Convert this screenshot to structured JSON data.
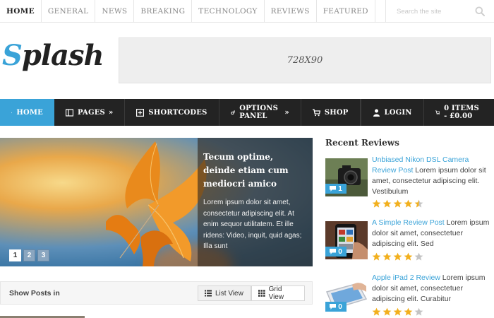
{
  "top_nav": {
    "items": [
      "HOME",
      "GENERAL",
      "NEWS",
      "BREAKING",
      "TECHNOLOGY",
      "REVIEWS",
      "FEATURED"
    ],
    "search_placeholder": "Search the site"
  },
  "header": {
    "logo_first": "S",
    "logo_rest": "plash",
    "ad_label": "728X90"
  },
  "main_nav": {
    "home": "HOME",
    "pages": "PAGES",
    "shortcodes": "SHORTCODES",
    "options_panel": "OPTIONS PANEL",
    "shop": "SHOP",
    "login": "LOGIN",
    "cart": "0 ITEMS - £0.00",
    "submenu_arrow": "»"
  },
  "slider": {
    "title": "Tecum optime, deinde etiam cum mediocri amico",
    "text": "Lorem ipsum dolor sit amet, consectetur adipiscing elit. At enim sequor utilitatem. Et ille ridens: Video, inquit, quid agas; Illa sunt",
    "pages": [
      "1",
      "2",
      "3"
    ],
    "active_page": 0
  },
  "show_posts": {
    "label": "Show Posts in",
    "list_view": "List View",
    "grid_view": "Grid View"
  },
  "sidebar": {
    "title": "Recent Reviews",
    "reviews": [
      {
        "link": "Unbiased Nikon DSL Camera Review Post",
        "text": " Lorem ipsum dolor sit amet, consectetur adipiscing elit. Vestibulum",
        "comments": "1",
        "rating": 4.5,
        "thumb": "camera"
      },
      {
        "link": "A Simple Review Post",
        "text": " Lorem ipsum dolor sit amet, consectetuer adipiscing elit. Sed",
        "comments": "0",
        "rating": 4,
        "thumb": "phone"
      },
      {
        "link": "Apple iPad 2 Review",
        "text": " Lorem ipsum dolor sit amet, consectetuer adipiscing elit. Curabitur",
        "comments": "0",
        "rating": 4,
        "thumb": "tablet"
      }
    ]
  },
  "colors": {
    "accent": "#3aa3d8",
    "nav_bg": "#232323",
    "star_filled": "#f2b01e",
    "star_empty": "#c4c4c4"
  }
}
